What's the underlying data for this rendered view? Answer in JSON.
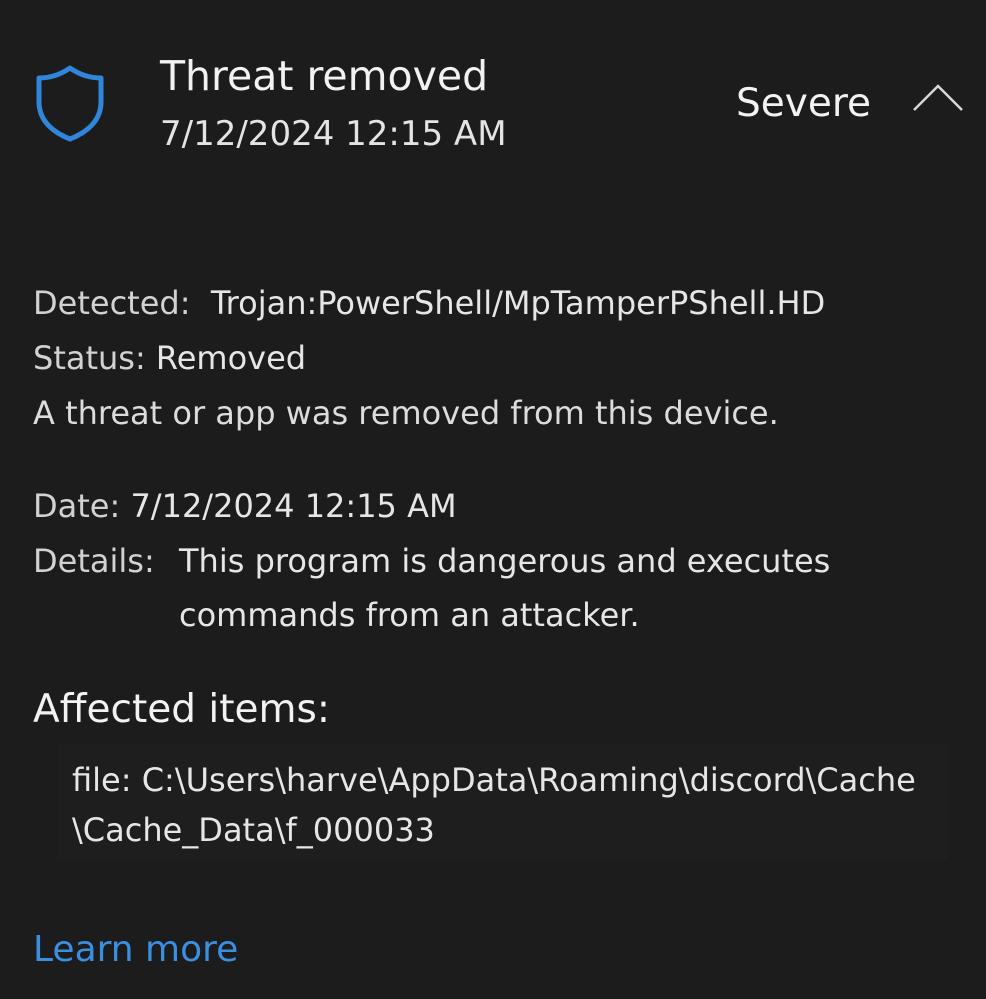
{
  "header": {
    "title": "Threat removed",
    "timestamp": "7/12/2024 12:15 AM",
    "severity": "Severe",
    "icon": "shield-icon",
    "collapse_icon": "chevron-up-icon"
  },
  "detected": {
    "label": "Detected:",
    "value": "Trojan:PowerShell/MpTamperPShell.HD"
  },
  "status": {
    "label": "Status:",
    "value": "Removed"
  },
  "description": "A threat or app was removed from this device.",
  "date": {
    "label": "Date:",
    "value": "7/12/2024 12:15 AM"
  },
  "details": {
    "label": "Details:",
    "value": "This program is dangerous and executes commands from an attacker."
  },
  "affected": {
    "heading": "Affected items:",
    "file_path": "file: C:\\Users\\harve\\AppData\\Roaming\\discord\\Cache\\Cache_Data\\f_000033"
  },
  "learn_more": "Learn more",
  "colors": {
    "background": "#1c1c1c",
    "accent": "#3a8fe0",
    "text": "#ececec"
  }
}
